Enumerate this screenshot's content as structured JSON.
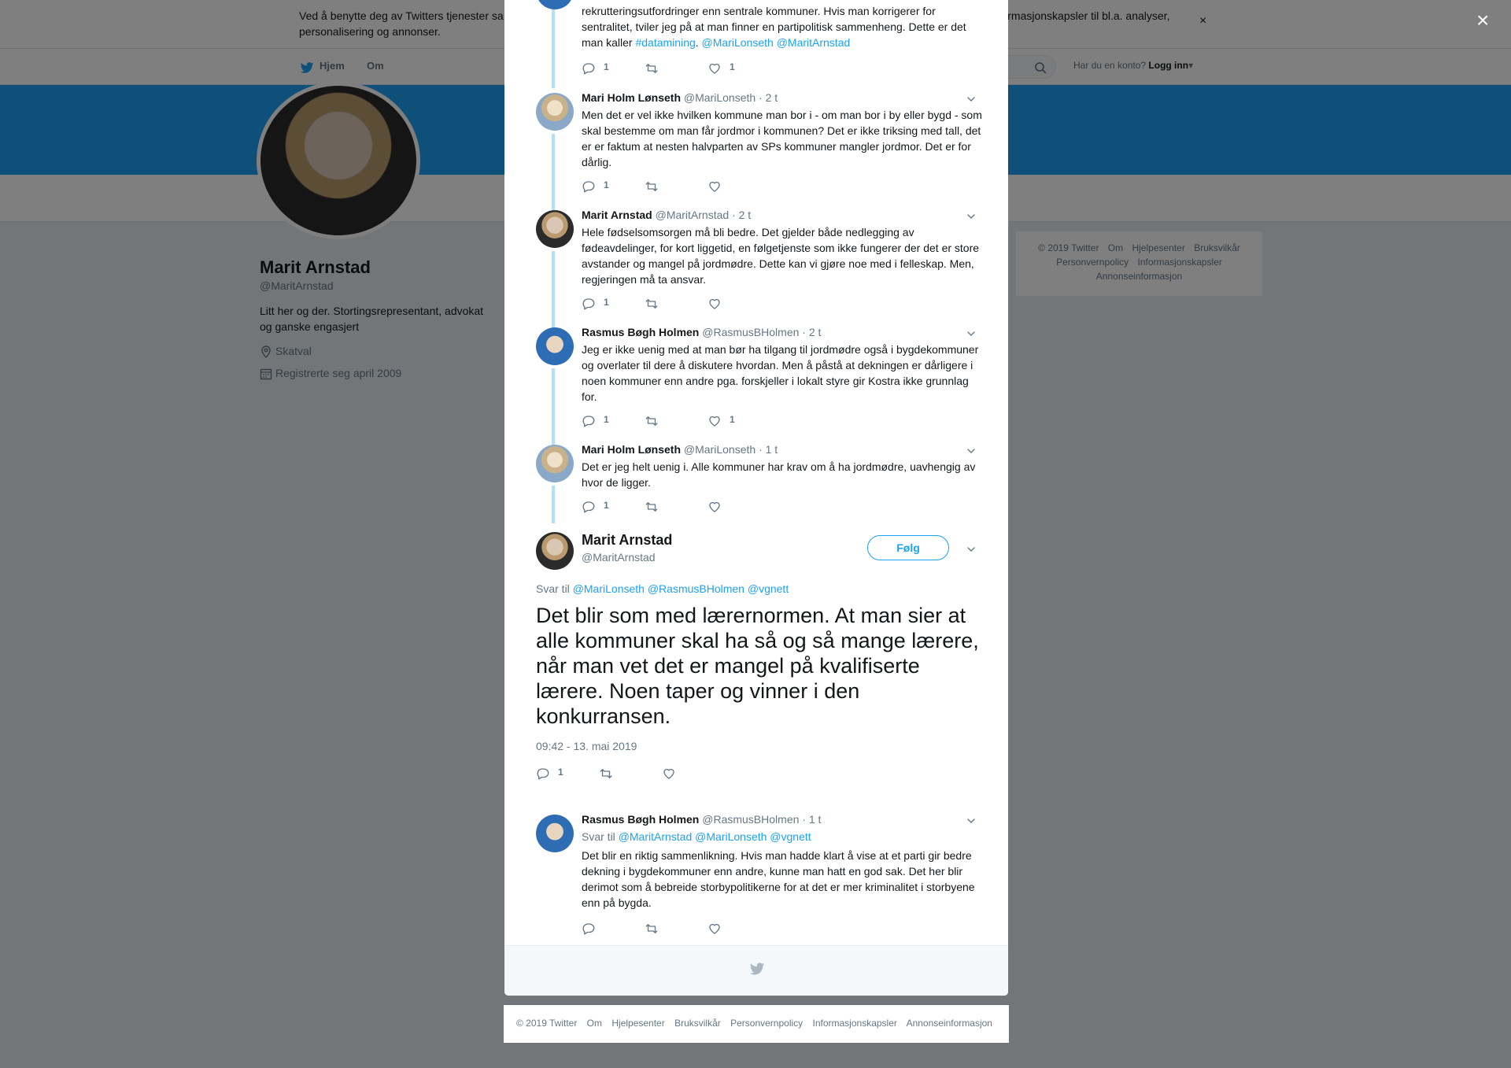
{
  "cookie": {
    "text_start": "Ved å benytte deg av Twitters tjenester sa",
    "text_end": "informasjonskapsler til bl.a. analyser,",
    "text_line2": "personalisering og annonser.",
    "close_symbol": "×"
  },
  "nav": {
    "home": "Hjem",
    "about": "Om",
    "account_prompt": "Har du en konto?",
    "login": "Logg inn"
  },
  "profile": {
    "name": "Marit Arnstad",
    "handle": "@MaritArnstad",
    "bio": "Litt her og der. Stortingsrepresentant, advokat og ganske engasjert",
    "location": "Skatval",
    "joined": "Registrerte seg april 2009"
  },
  "side_footer": {
    "items": [
      "© 2019 Twitter",
      "Om",
      "Hjelpesenter",
      "Bruksvilkår",
      "Personvernpolicy",
      "Informasjonskapsler",
      "Annonseinformasjon"
    ]
  },
  "overlay_close": "×",
  "replies": [
    {
      "text_lines": "rekrutteringsutfordringer enn sentrale kommuner. Hvis man korrigerer for sentralitet, tviler jeg på at man finner en partipolitisk sammenheng. Dette er det man kaller",
      "hashtag": "#datamining",
      "mentions": "@MariLonseth @MaritArnstad",
      "replies": "1",
      "likes": "1"
    },
    {
      "name": "Mari Holm Lønseth",
      "handle": "@MariLonseth",
      "time": "· 2 t",
      "text": "Men det er vel ikke hvilken kommune man bor i - om man bor i by eller bygd - som skal bestemme om man får jordmor i kommunen? Det er ikke triksing med tall, det er er faktum at nesten halvparten av SPs kommuner mangler jordmor. Det er for dårlig.",
      "replies": "1",
      "likes": ""
    },
    {
      "name": "Marit Arnstad",
      "handle": "@MaritArnstad",
      "time": "· 2 t",
      "text": "Hele fødselsomsorgen må bli bedre. Det gjelder både nedlegging av fødeavdelinger, for kort liggetid, en følgetjenste som ikke fungerer der det er store avstander og mangel på jordmødre. Dette kan vi gjøre noe med i felleskap. Men, regjeringen må ta ansvar.",
      "replies": "1",
      "likes": ""
    },
    {
      "name": "Rasmus Bøgh Holmen",
      "handle": "@RasmusBHolmen",
      "time": "· 2 t",
      "text": "Jeg er ikke uenig med at man bør ha tilgang til jordmødre også i bygdekommuner og overlater til dere å diskutere hvordan. Men å påstå at dekningen er dårligere i noen kommuner enn andre pga. forskjeller i lokalt styre gir Kostra ikke grunnlag for.",
      "replies": "1",
      "likes": "1"
    },
    {
      "name": "Mari Holm Lønseth",
      "handle": "@MariLonseth",
      "time": "· 1 t",
      "text": "Det er jeg helt uenig i. Alle kommuner har krav om å ha jordmødre, uavhengig av hvor de ligger.",
      "replies": "1",
      "likes": ""
    }
  ],
  "main_tweet": {
    "name": "Marit Arnstad",
    "handle": "@MaritArnstad",
    "follow": "Følg",
    "reply_to_prefix": "Svar til",
    "reply_to_mentions": "@MariLonseth @RasmusBHolmen @vgnett",
    "text": "Det blir som med lærernormen. At man sier at alle kommuner skal ha så og så mange lærere, når man vet det er mangel på kvalifiserte lærere. Noen taper og vinner i den konkurransen.",
    "date": "09:42 - 13. mai 2019",
    "replies": "1"
  },
  "after_reply": {
    "name": "Rasmus Bøgh Holmen",
    "handle": "@RasmusBHolmen",
    "time": "· 1 t",
    "reply_to_prefix": "Svar til",
    "reply_to_mentions": "@MaritArnstad @MariLonseth @vgnett",
    "text": "Det blir en riktig sammenlikning. Hvis man hadde klart å vise at et parti gir bedre dekning i bygdekommuner enn andre, kunne man hatt en god sak. Det her blir derimot som å bebreide storbypolitikerne for at det er mer kriminalitet i storbyene enn på bygda."
  },
  "page_footer": {
    "items": [
      "© 2019 Twitter",
      "Om",
      "Hjelpesenter",
      "Bruksvilkår",
      "Personvernpolicy",
      "Informasjonskapsler",
      "Annonseinformasjon"
    ]
  },
  "colors": {
    "accent": "#1da1f2",
    "thread_line": "#b2dffc",
    "muted": "#657786"
  },
  "icons": {
    "reply": "reply-icon",
    "retweet": "retweet-icon",
    "like": "heart-icon",
    "caret": "chevron-down-icon",
    "bird": "twitter-bird-icon",
    "search": "search-icon",
    "location": "location-pin-icon",
    "calendar": "calendar-icon"
  }
}
